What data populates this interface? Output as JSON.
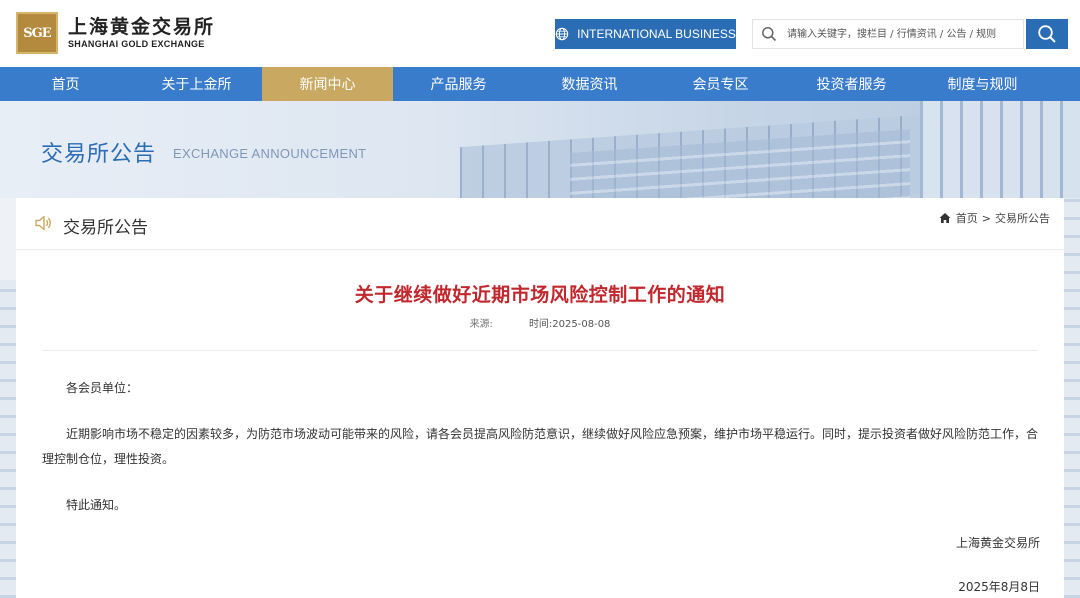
{
  "header": {
    "logo_mark": "SGE",
    "logo_cn": "上海黄金交易所",
    "logo_en": "SHANGHAI GOLD EXCHANGE",
    "intl_button": "INTERNATIONAL BUSINESS",
    "search_placeholder": "请输入关键字，搜栏目 / 行情资讯 / 公告 / 规则"
  },
  "nav": {
    "items": [
      {
        "label": "首页"
      },
      {
        "label": "关于上金所"
      },
      {
        "label": "新闻中心"
      },
      {
        "label": "产品服务"
      },
      {
        "label": "数据资讯"
      },
      {
        "label": "会员专区"
      },
      {
        "label": "投资者服务"
      },
      {
        "label": "制度与规则"
      }
    ],
    "active_index": 2
  },
  "banner": {
    "title": "交易所公告",
    "subtitle": "EXCHANGE ANNOUNCEMENT"
  },
  "section": {
    "title": "交易所公告",
    "breadcrumb": [
      "首页",
      "交易所公告"
    ],
    "breadcrumb_sep": ">"
  },
  "article": {
    "title": "关于继续做好近期市场风险控制工作的通知",
    "source_label": "来源:",
    "time_label": "时间:2025-08-08",
    "greeting": "各会员单位：",
    "paragraph": "近期影响市场不稳定的因素较多，为防范市场波动可能带来的风险，请各会员提高风险防范意识，继续做好风险应急预案，维护市场平稳运行。同时，提示投资者做好风险防范工作，合理控制仓位，理性投资。",
    "closing": "特此通知。",
    "signature": "上海黄金交易所",
    "date": "2025年8月8日"
  },
  "colors": {
    "brand_blue": "#2a6db5",
    "nav_blue": "#3a7ccc",
    "active_gold": "#c9a961",
    "title_red": "#c0282d"
  },
  "icons": {
    "globe": "globe-icon",
    "search": "search-icon",
    "speaker": "speaker-icon",
    "home": "home-icon"
  }
}
